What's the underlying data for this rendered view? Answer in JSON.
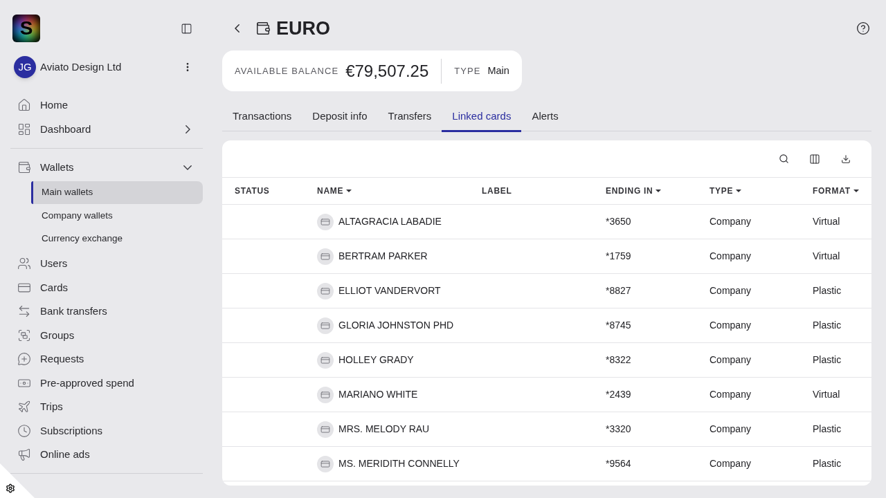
{
  "sidebar": {
    "logo_text": "S",
    "account": {
      "initials": "JG",
      "name": "Aviato Design Ltd"
    },
    "sections": [
      {
        "items": [
          {
            "label": "Home",
            "selected": false
          },
          {
            "label": "Dashboard",
            "selected": false,
            "expanded": false
          }
        ]
      },
      {
        "items": [
          {
            "label": "Wallets",
            "selected": false,
            "expanded": true,
            "children": [
              {
                "label": "Main wallets",
                "selected": true
              },
              {
                "label": "Company wallets",
                "selected": false
              },
              {
                "label": "Currency exchange",
                "selected": false
              }
            ]
          },
          {
            "label": "Users",
            "selected": false
          },
          {
            "label": "Cards",
            "selected": false
          },
          {
            "label": "Bank transfers",
            "selected": false
          },
          {
            "label": "Groups",
            "selected": false
          },
          {
            "label": "Requests",
            "selected": false
          },
          {
            "label": "Pre-approved spend",
            "selected": false
          },
          {
            "label": "Trips",
            "selected": false
          },
          {
            "label": "Subscriptions",
            "selected": false
          },
          {
            "label": "Online ads",
            "selected": false
          }
        ]
      }
    ]
  },
  "header": {
    "title": "EURO"
  },
  "balance": {
    "label": "AVAILABLE BALANCE",
    "amount": "€79,507.25",
    "type_label": "TYPE",
    "type_value": "Main"
  },
  "tabs": [
    {
      "label": "Transactions",
      "selected": false
    },
    {
      "label": "Deposit info",
      "selected": false
    },
    {
      "label": "Transfers",
      "selected": false
    },
    {
      "label": "Linked cards",
      "selected": true
    },
    {
      "label": "Alerts",
      "selected": false
    }
  ],
  "table": {
    "columns": [
      {
        "label": "STATUS",
        "sortable": false
      },
      {
        "label": "NAME",
        "sortable": true
      },
      {
        "label": "LABEL",
        "sortable": false
      },
      {
        "label": "ENDING IN",
        "sortable": true
      },
      {
        "label": "TYPE",
        "sortable": true
      },
      {
        "label": "FORMAT",
        "sortable": true
      }
    ],
    "rows": [
      {
        "name": "ALTAGRACIA LABADIE",
        "ending_in": "*3650",
        "type": "Company",
        "format": "Virtual"
      },
      {
        "name": "BERTRAM PARKER",
        "ending_in": "*1759",
        "type": "Company",
        "format": "Virtual"
      },
      {
        "name": "ELLIOT VANDERVORT",
        "ending_in": "*8827",
        "type": "Company",
        "format": "Plastic"
      },
      {
        "name": "GLORIA JOHNSTON PHD",
        "ending_in": "*8745",
        "type": "Company",
        "format": "Plastic"
      },
      {
        "name": "HOLLEY GRADY",
        "ending_in": "*8322",
        "type": "Company",
        "format": "Plastic"
      },
      {
        "name": "MARIANO WHITE",
        "ending_in": "*2439",
        "type": "Company",
        "format": "Virtual"
      },
      {
        "name": "MRS. MELODY RAU",
        "ending_in": "*3320",
        "type": "Company",
        "format": "Plastic"
      },
      {
        "name": "MS. MERIDITH CONNELLY",
        "ending_in": "*9564",
        "type": "Company",
        "format": "Plastic"
      }
    ]
  }
}
